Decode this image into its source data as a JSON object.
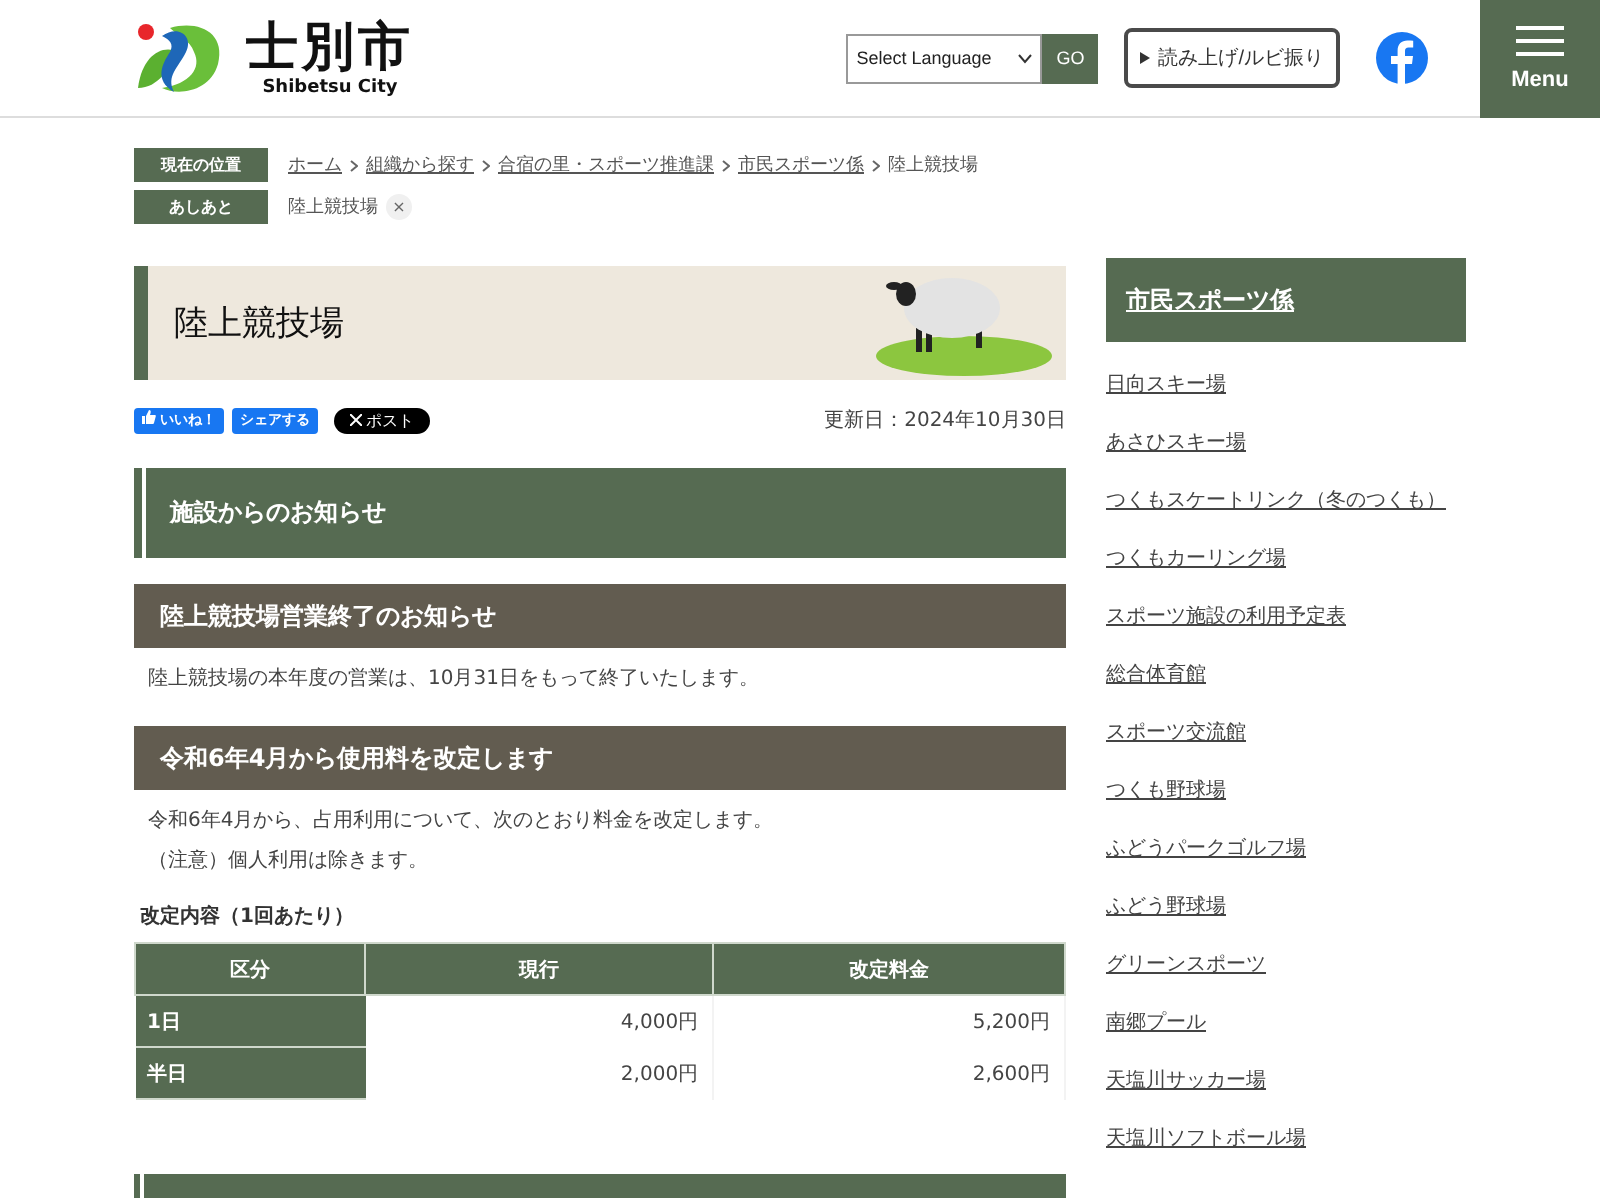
{
  "header": {
    "logo_title": "士別市",
    "logo_subtitle": "Shibetsu City",
    "language_select": "Select Language",
    "go_button": "GO",
    "read_aloud_button": "読み上げ/ルビ振り",
    "menu_label": "Menu"
  },
  "breadcrumb": {
    "label": "現在の位置",
    "items": [
      {
        "text": "ホーム",
        "link": true
      },
      {
        "text": "組織から探す",
        "link": true
      },
      {
        "text": "合宿の里・スポーツ推進課",
        "link": true
      },
      {
        "text": "市民スポーツ係",
        "link": true
      },
      {
        "text": "陸上競技場",
        "link": false
      }
    ]
  },
  "history": {
    "label": "あしあと",
    "items": [
      "陸上競技場"
    ],
    "close": "×"
  },
  "page_title": "陸上競技場",
  "social": {
    "like": "いいね！",
    "share": "シェアする",
    "post": "ポスト"
  },
  "updated": "更新日：2024年10月30日",
  "section_heading": "施設からのお知らせ",
  "notices": [
    {
      "heading": "陸上競技場営業終了のお知らせ",
      "paragraphs": [
        "陸上競技場の本年度の営業は、10月31日をもって終了いたします。"
      ]
    },
    {
      "heading": "令和6年4月から使用料を改定します",
      "paragraphs": [
        "令和6年4月から、占用利用について、次のとおり料金を改定します。",
        "（注意）個人利用は除きます。"
      ]
    }
  ],
  "table": {
    "caption": "改定内容（1回あたり）",
    "columns": [
      "区分",
      "現行",
      "改定料金"
    ],
    "rows": [
      [
        "1日",
        "4,000円",
        "5,200円"
      ],
      [
        "半日",
        "2,000円",
        "2,600円"
      ]
    ]
  },
  "sidebar": {
    "title": "市民スポーツ係",
    "items": [
      "日向スキー場",
      "あさひスキー場",
      "つくもスケートリンク（冬のつくも）",
      "つくもカーリング場",
      "スポーツ施設の利用予定表",
      "総合体育館",
      "スポーツ交流館",
      "つくも野球場",
      "ふどうパークゴルフ場",
      "ふどう野球場",
      "グリーンスポーツ",
      "南郷プール",
      "天塩川サッカー場",
      "天塩川ソフトボール場"
    ]
  }
}
